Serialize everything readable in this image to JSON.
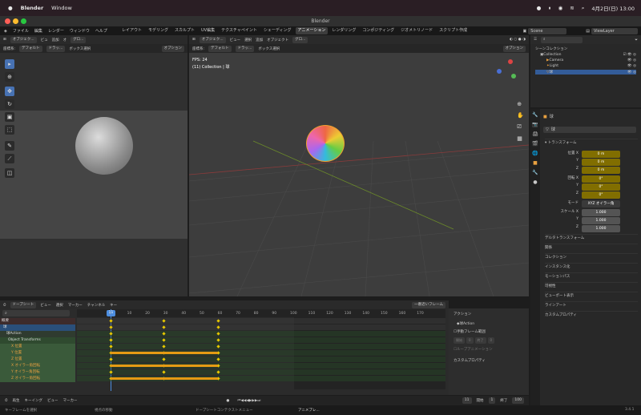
{
  "mac": {
    "app": "Blender",
    "menu1": "Window",
    "datetime": "4月2日(日) 13:00"
  },
  "window_title": "Blender",
  "topbar": {
    "menus": [
      "ファイル",
      "編集",
      "レンダー",
      "ウィンドウ",
      "ヘルプ"
    ],
    "workspaces": [
      "レイアウト",
      "モデリング",
      "スカルプト",
      "UV編集",
      "テクスチャペイント",
      "シェーディング",
      "アニメーション",
      "レンダリング",
      "コンポジティング",
      "ジオメトリノード",
      "スクリプト作成"
    ],
    "active_workspace": "アニメーション",
    "scene": "Scene",
    "view_layer": "ViewLayer"
  },
  "left_view": {
    "mode": "オブジェク...",
    "view": "ビュ",
    "add": "追加",
    "obj": "オ",
    "group": "グロ...",
    "coord_label": "座標系:",
    "coord": "デフォルト",
    "drag": "ドラッ...",
    "box": "ボックス選択",
    "options": "オプション"
  },
  "main_view": {
    "mode": "オブジェク...",
    "view": "ビュー",
    "select": "選択",
    "add": "追加",
    "object": "オブジェクト",
    "group": "グロ...",
    "coord_label": "座標系:",
    "coord": "デフォルト",
    "drag": "ドラッ...",
    "box": "ボックス選択",
    "options": "オプション",
    "fps": "FPS: 24",
    "collection": "(11) Collection | 球"
  },
  "outliner": {
    "title": "シーンコレクション",
    "items": [
      {
        "label": "Collection"
      },
      {
        "label": "Camera"
      },
      {
        "label": "Light"
      },
      {
        "label": "球"
      }
    ]
  },
  "properties": {
    "object_name": "球",
    "data_name": "球",
    "transform_title": "トランスフォーム",
    "location_label": "位置 X",
    "y": "Y",
    "z": "Z",
    "loc": [
      "0 m",
      "0 m",
      "0 m"
    ],
    "rotation_label": "回転 X",
    "rot": [
      "0°",
      "0°",
      "0°"
    ],
    "mode_label": "モード",
    "mode": "XYZ オイラー角",
    "scale_label": "スケール X",
    "scale": [
      "1.000",
      "1.000",
      "1.000"
    ],
    "sections": [
      "デルタトランスフォーム",
      "関係",
      "コレクション",
      "インスタンス化",
      "モーションパス",
      "可視性",
      "ビューポート表示",
      "ラインアート",
      "カスタムプロパティ"
    ]
  },
  "dope": {
    "mode": "ドープシート",
    "menus": [
      "ビュー",
      "選択",
      "マーカー",
      "チャンネル",
      "キー"
    ],
    "filter": "一番近いフレーム",
    "frames": [
      "1",
      "10",
      "20",
      "30",
      "40",
      "50",
      "60",
      "70",
      "80",
      "90",
      "100",
      "110",
      "120",
      "130",
      "140",
      "150",
      "160",
      "170"
    ],
    "channels": [
      "概要",
      "球",
      "球Action",
      "Object Transforms",
      "X 位置",
      "Y 位置",
      "Z 位置",
      "X オイラー角回転",
      "Y オイラー角回転",
      "Z オイラー角回転"
    ]
  },
  "npanel": {
    "title": "アクション",
    "action": "球Action",
    "manual": "手動フレーム範囲",
    "start": "開始",
    "start_val": "0",
    "end": "終了",
    "end_val": "0",
    "loop": "ループアニメーション",
    "custom": "カスタムプロパティ"
  },
  "timeline": {
    "playback": "再生",
    "keying": "キーイング",
    "view": "ビュー",
    "marker": "マーカー",
    "frame": "11",
    "start_label": "開始",
    "start": "1",
    "end_label": "終了",
    "end": "100"
  },
  "status": {
    "a": "キーフレームを選択",
    "b": "視点の移動",
    "c": "ドープシートコンテクストメニュー",
    "d": "アニメプレ...",
    "version": "3.4.1"
  }
}
